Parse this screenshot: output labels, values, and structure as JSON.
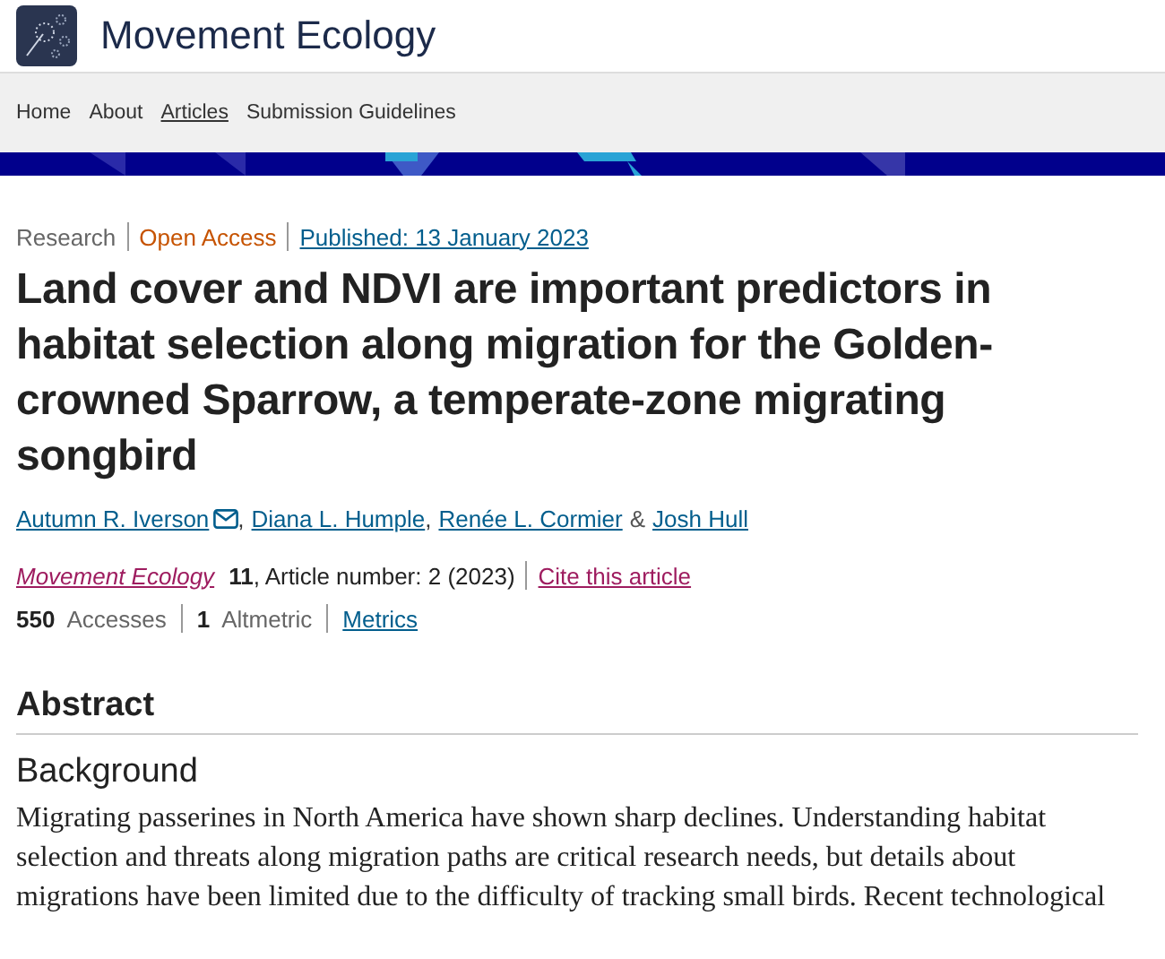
{
  "site": {
    "title": "Movement Ecology"
  },
  "nav": [
    {
      "label": "Home",
      "selected": false
    },
    {
      "label": "About",
      "selected": false
    },
    {
      "label": "Articles",
      "selected": true
    },
    {
      "label": "Submission Guidelines",
      "selected": false
    }
  ],
  "article": {
    "type": "Research",
    "access": "Open Access",
    "published": "Published: 13 January 2023",
    "title": "Land cover and NDVI are important predictors in habitat selection along migration for the Golden-crowned Sparrow, a temperate-zone migrating songbird",
    "authors": [
      {
        "name": "Autumn R. Iverson",
        "corresponding": true,
        "sep": ","
      },
      {
        "name": "Diana L. Humple",
        "corresponding": false,
        "sep": ","
      },
      {
        "name": "Renée L. Cormier",
        "corresponding": false,
        "sep": "&"
      },
      {
        "name": "Josh Hull",
        "corresponding": false
      }
    ],
    "journal": "Movement Ecology",
    "volume": "11",
    "article_number": ", Article number: 2 (2023)",
    "cite": "Cite this article",
    "metrics": [
      "**550**  Accesses",
      "**1**  Altmetric"
    ],
    "metrics_link": "Metrics"
  },
  "abstract": {
    "heading": "Abstract",
    "section": "Background",
    "text": "Migrating passerines in North America have shown sharp declines. Understanding habitat selection and threats along migration paths are critical research needs, but details about migrations have been limited due to the difficulty of tracking small birds. Recent technological"
  }
}
